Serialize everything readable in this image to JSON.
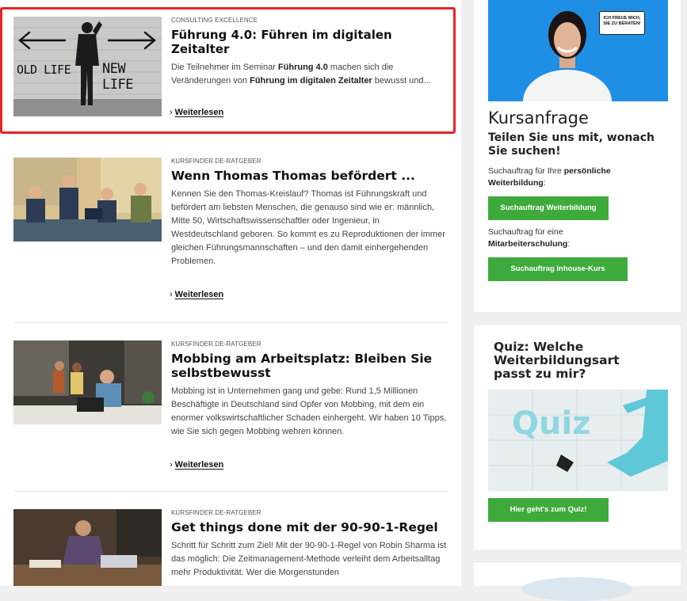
{
  "articles": [
    {
      "kicker": "CONSULTING EXCELLENCE",
      "title": "Führung 4.0: Führen im digitalen Zeitalter",
      "excerpt_parts": [
        "Die Teilnehmer im Seminar ",
        "Führung 4.0",
        " machen sich die Veränderungen von ",
        "Führung im digitalen Zeitalter",
        " bewusst und..."
      ],
      "readmore": "Weiterlesen",
      "image_text_left": "OLD LIFE",
      "image_text_right": "NEW LIFE"
    },
    {
      "kicker": "KURSFINDER.DE-RATGEBER",
      "title": "Wenn Thomas Thomas befördert ...",
      "excerpt": "Kennen Sie den Thomas-Kreislauf? Thomas ist Führungskraft und befördert am liebsten Menschen, die genauso sind wie er: männlich, Mitte 50, Wirtschaftswissenschaftler oder Ingenieur, in Westdeutschland geboren. So kommt es zu Reproduktionen der immer gleichen Führungsmannschaften – und den damit einhergehenden Problemen.",
      "readmore": "Weiterlesen"
    },
    {
      "kicker": "KURSFINDER.DE-RATGEBER",
      "title": "Mobbing am Arbeitsplatz: Bleiben Sie selbstbewusst",
      "excerpt": "Mobbing ist in Unternehmen gang und gebe: Rund 1,5 Millionen Beschäftigte in Deutschland sind Opfer von Mobbing, mit dem ein enormer volkswirtschaftlicher Schaden einhergeht. Wir haben 10 Tipps, wie Sie sich gegen Mobbing wehren können.",
      "readmore": "Weiterlesen"
    },
    {
      "kicker": "KURSFINDER.DE-RATGEBER",
      "title": "Get things done mit der 90-90-1-Regel",
      "excerpt": "Schritt für Schritt zum Ziel! Mit der 90-90-1-Regel von Robin Sharma ist das möglich: Die Zeitmanagement-Methode verleiht dem Arbeitsalltag mehr Produktivität. Wer die Morgenstunden"
    }
  ],
  "kursanfrage": {
    "speech_bubble": "ICH FREUE MICH, SIE ZU BERATEN!",
    "heading": "Kursanfrage",
    "subheading": "Teilen Sie uns mit, wonach Sie suchen!",
    "text1_prefix": "Suchauftrag für Ihre ",
    "text1_bold": "persönliche Weiterbildung",
    "text1_suffix": ":",
    "button1": "Suchauftrag Weiterbildung",
    "text2_prefix": "Suchauftrag für eine ",
    "text2_bold": "Mitarbeiterschulung",
    "text2_suffix": ":",
    "button2": "Suchauftrag Inhouse-Kurs"
  },
  "quiz": {
    "heading": "Quiz: Welche Weiterbildungsart passt zu mir?",
    "image_word": "Quiz",
    "button": "Hier geht's zum Quiz!"
  },
  "colors": {
    "highlight_border": "#e32525",
    "button_green": "#3faa3c",
    "kursanfrage_image_bg": "#1f8fe6",
    "quiz_image_bg": "#e8edf0"
  }
}
